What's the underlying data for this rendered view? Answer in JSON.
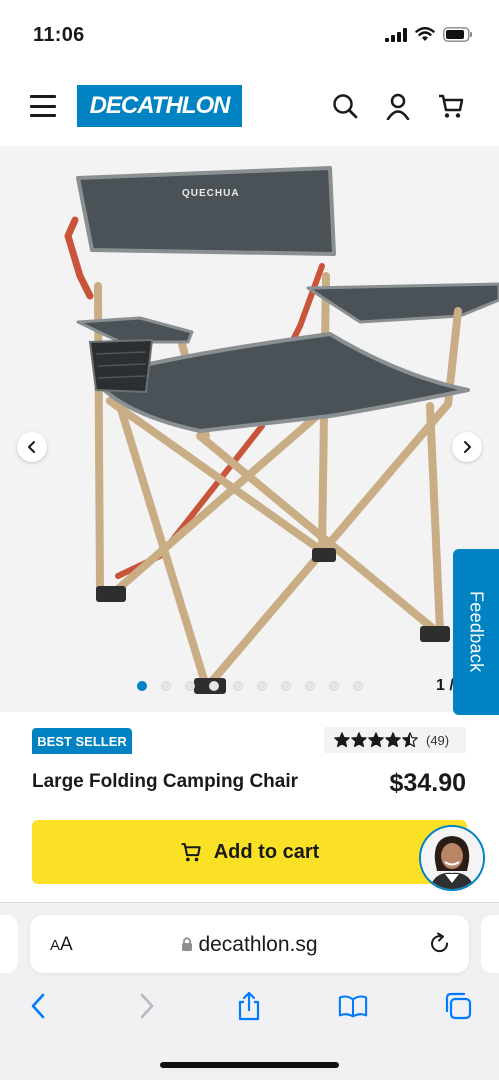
{
  "status_bar": {
    "time": "11:06"
  },
  "header": {
    "logo_text": "DECATHLON"
  },
  "gallery": {
    "brand_on_chair": "QUECHUA",
    "dot_count": 10,
    "active_dot_index": 0,
    "counter": "1 /"
  },
  "feedback": {
    "label": "Feedback"
  },
  "product": {
    "badge": "BEST SELLER",
    "rating": 4.5,
    "rating_count": "(49)",
    "title": "Large Folding Camping Chair",
    "price": "$34.90"
  },
  "cart_button": {
    "label": "Add to cart"
  },
  "browser": {
    "text_size_big": "A",
    "text_size_small": "A",
    "url": "decathlon.sg"
  },
  "colors": {
    "brand_blue": "#0082c3",
    "cart_yellow": "#fbe126",
    "chair_fabric": "#4a5257",
    "chair_frame": "#c9ad84",
    "strap_orange": "#c8553a"
  },
  "icons": {
    "menu": "hamburger-icon",
    "search": "search-icon",
    "account": "user-icon",
    "cart": "cart-icon",
    "prev": "chevron-left-icon",
    "next": "chevron-right-icon",
    "reload": "reload-icon",
    "back": "back-arrow-icon",
    "forward": "forward-arrow-icon",
    "share": "share-icon",
    "bookmarks": "book-icon",
    "tabs": "tabs-icon"
  }
}
